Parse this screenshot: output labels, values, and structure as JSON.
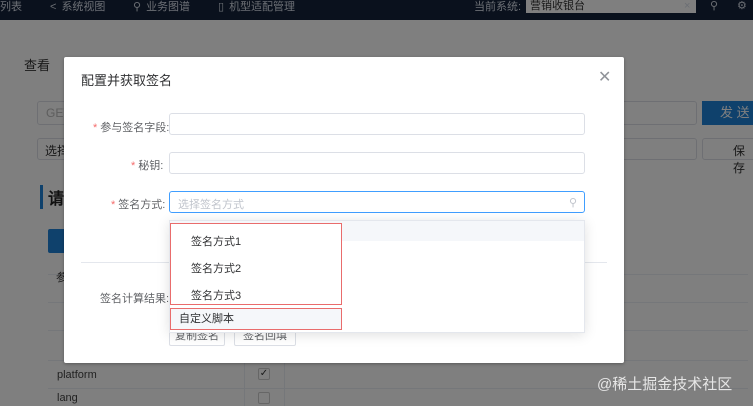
{
  "topbar": {
    "nav_items": [
      {
        "label": "列表"
      },
      {
        "label": "系统视图",
        "icon": "share-icon"
      },
      {
        "label": "业务图谱",
        "icon": "person-icon"
      },
      {
        "label": "机型适配管理",
        "icon": "phone-icon"
      }
    ],
    "current_system_label": "当前系统:",
    "current_system_value": "营销收银台",
    "icons": [
      "dismiss-icon",
      "search-icon",
      "gear-icon"
    ]
  },
  "background": {
    "tab_label": "查看",
    "url_placeholder": "GET",
    "send_label": "发 送",
    "select_label": "选择",
    "save_label": "保存",
    "section_title": "请",
    "param_label": "参",
    "row_label": "platform",
    "row_label2": "lang"
  },
  "dialog": {
    "title": "配置并获取签名",
    "fields": {
      "sign_fields_label": "参与签名字段:",
      "secret_label": "秘钥:",
      "method_label": "签名方式:",
      "method_placeholder": "选择签名方式",
      "result_label": "签名计算结果:"
    },
    "dropdown": {
      "options": [
        "签名方式1",
        "签名方式2",
        "签名方式3"
      ],
      "custom_option": "自定义脚本"
    },
    "buttons": {
      "copy_label": "复制签名",
      "fill_label": "签名回填"
    }
  },
  "watermark": "@稀土掘金技术社区",
  "colors": {
    "topbar": "#15233a",
    "primary": "#1f83d9",
    "required": "#f56c6c",
    "highlight_box": "#e96c6c",
    "focus_border": "#409eff"
  }
}
